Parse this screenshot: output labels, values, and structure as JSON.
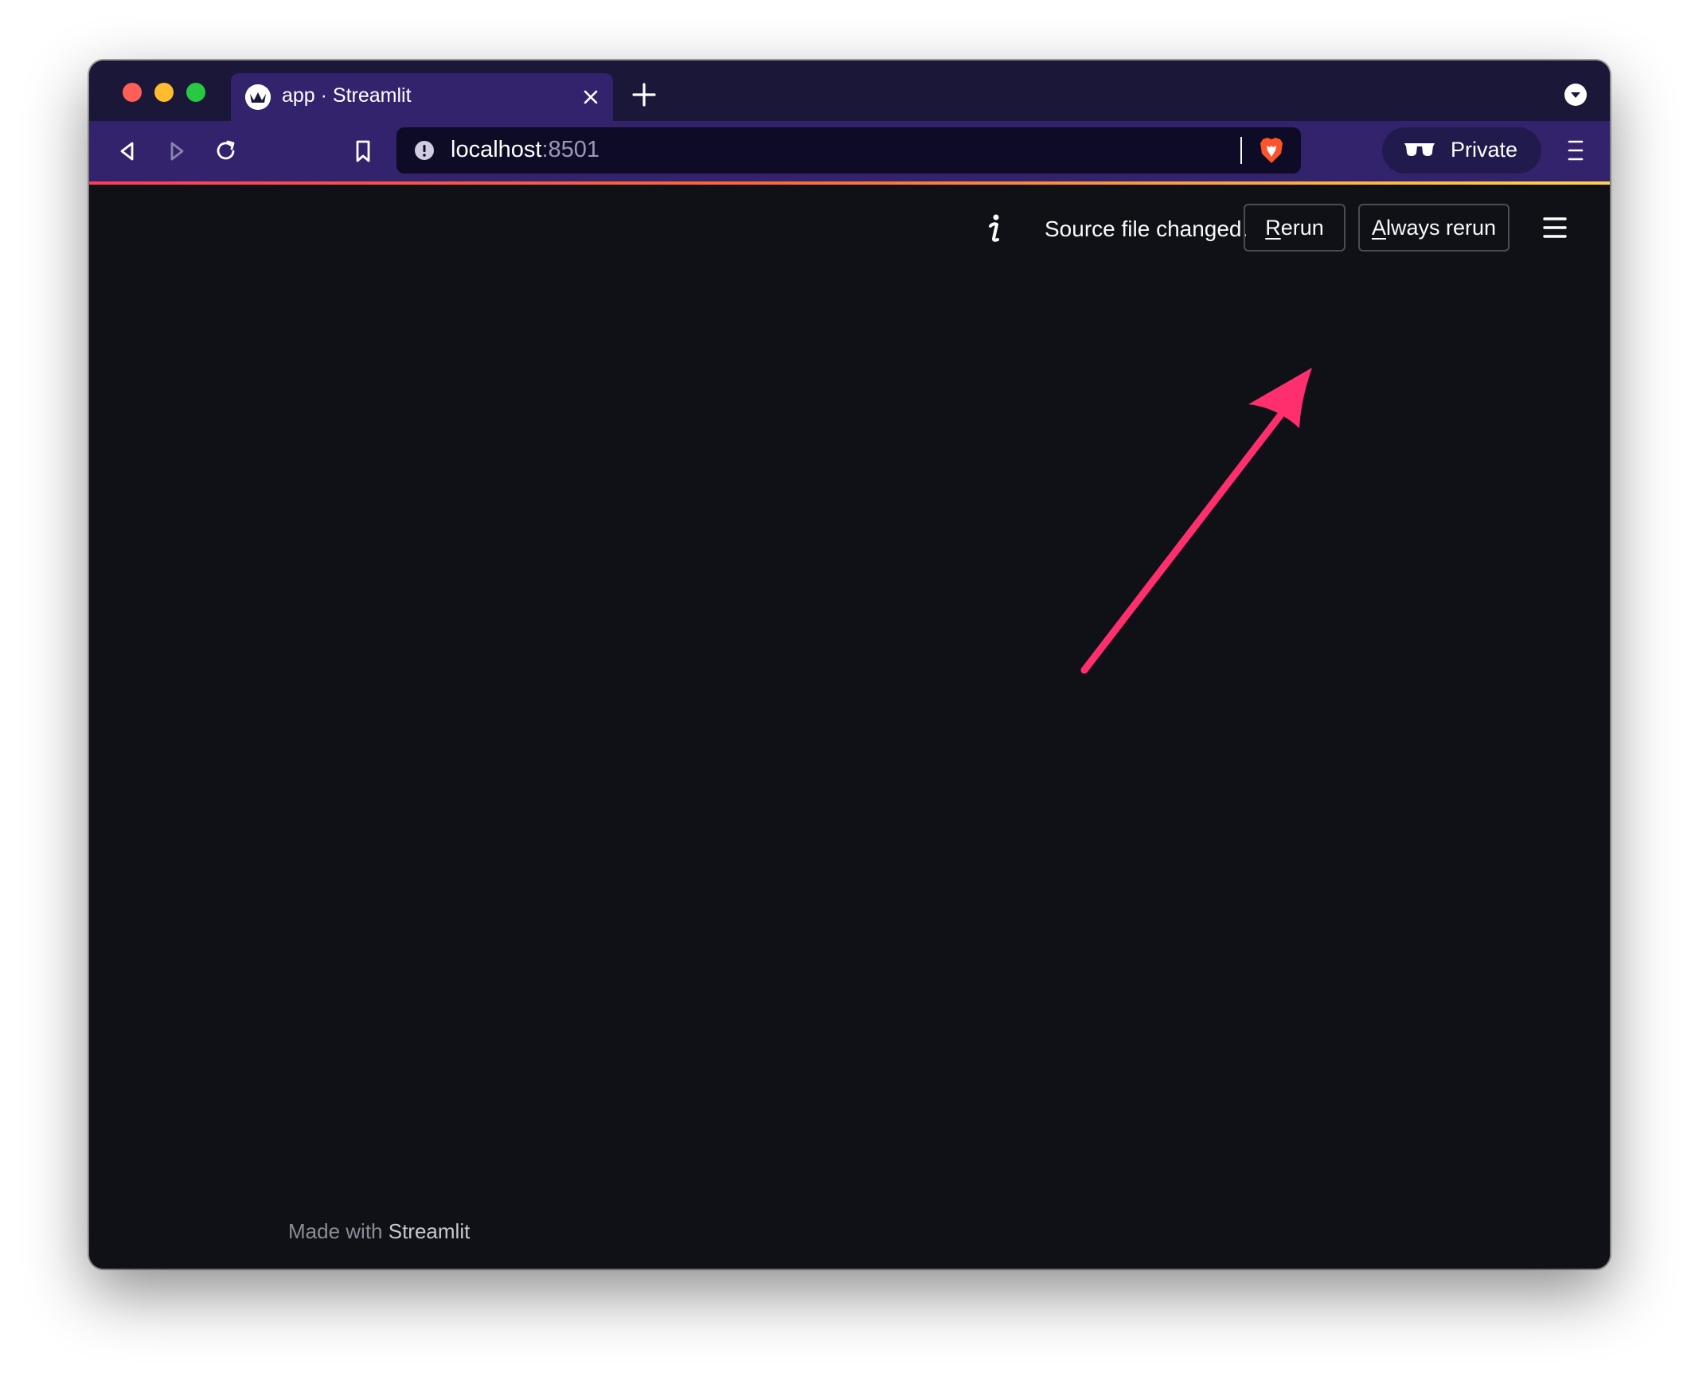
{
  "tab": {
    "title": "app · Streamlit",
    "favicon": "streamlit-crown-icon"
  },
  "toolbar": {
    "url_host": "localhost",
    "url_port": ":8501",
    "private_label": "Private"
  },
  "status": {
    "message": "Source file changed.",
    "rerun_first": "R",
    "rerun_rest": "erun",
    "always_first": "A",
    "always_rest": "lways rerun"
  },
  "footer": {
    "made_with": "Made with ",
    "brand": "Streamlit"
  },
  "colors": {
    "page_background": "#0f1117",
    "tab_strip": "#1b1738",
    "toolbar": "#33236d",
    "arrow": "#ff2f6e"
  },
  "icons": [
    "back-icon",
    "forward-icon",
    "reload-icon",
    "bookmark-icon",
    "site-warning-icon",
    "brave-shield-icon",
    "private-glasses-icon",
    "info-icon",
    "hamburger-menu-icon"
  ]
}
